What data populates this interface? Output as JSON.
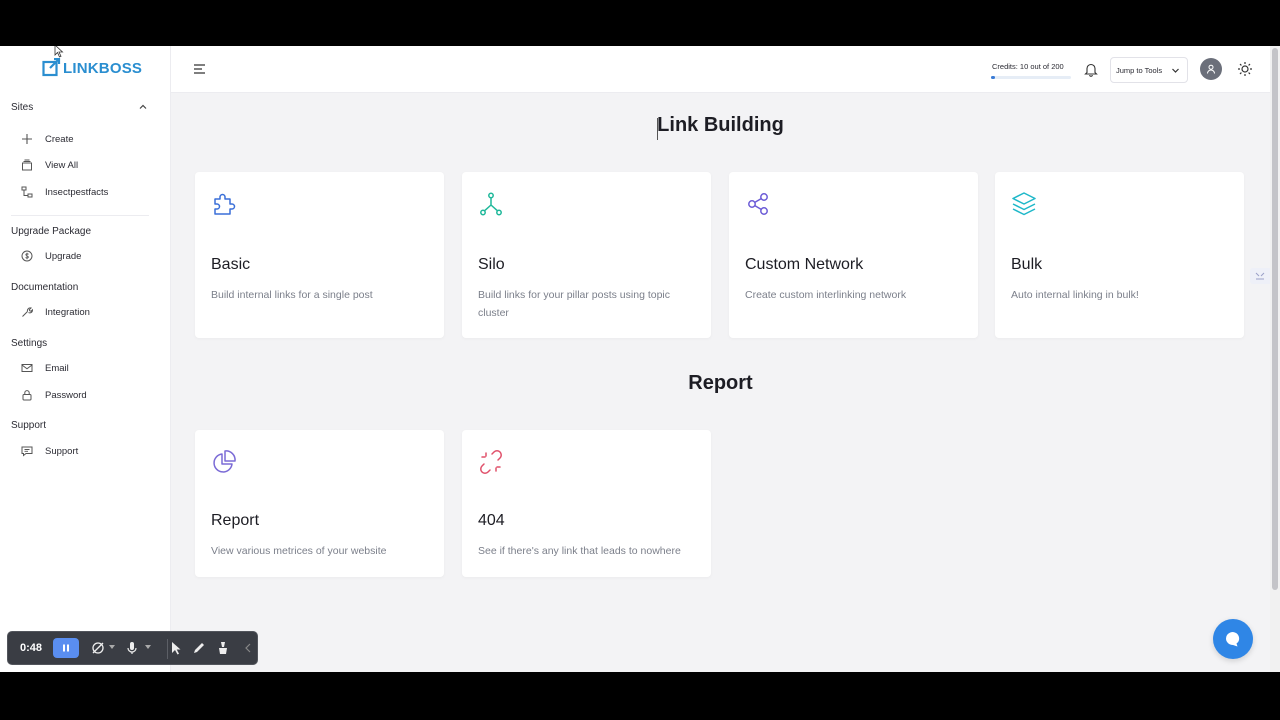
{
  "sidebar": {
    "logo_text": "LINKBOSS",
    "sites_heading": "Sites",
    "sites_items": [
      {
        "label": "Create",
        "icon": "plus-icon"
      },
      {
        "label": "View All",
        "icon": "stack-icon"
      },
      {
        "label": "Insectpestfacts",
        "icon": "sitemap-icon"
      }
    ],
    "upgrade_heading": "Upgrade Package",
    "upgrade_item": {
      "label": "Upgrade",
      "icon": "dollar-circle-icon"
    },
    "docs_heading": "Documentation",
    "docs_item": {
      "label": "Integration",
      "icon": "tool-icon"
    },
    "settings_heading": "Settings",
    "settings_items": [
      {
        "label": "Email",
        "icon": "mail-icon"
      },
      {
        "label": "Password",
        "icon": "lock-icon"
      }
    ],
    "support_heading": "Support",
    "support_item": {
      "label": "Support",
      "icon": "chat-icon"
    }
  },
  "header": {
    "credits_text": "Credits: 10 out of 200",
    "credits_used": 10,
    "credits_total": 200,
    "jump_label": "Jump to Tools"
  },
  "link_building": {
    "title": "Link Building",
    "cards": [
      {
        "title": "Basic",
        "desc": "Build internal links for a single post",
        "icon": "puzzle-icon",
        "color": "#3a6fd8"
      },
      {
        "title": "Silo",
        "desc": "Build links for your pillar posts using topic cluster",
        "icon": "hierarchy-icon",
        "color": "#1fb89a"
      },
      {
        "title": "Custom Network",
        "desc": "Create custom interlinking network",
        "icon": "share-nodes-icon",
        "color": "#6b5bd6"
      },
      {
        "title": "Bulk",
        "desc": "Auto internal linking in bulk!",
        "icon": "layers-icon",
        "color": "#1fb8c9"
      }
    ]
  },
  "report": {
    "title": "Report",
    "cards": [
      {
        "title": "Report",
        "desc": "View various metrices of your website",
        "icon": "pie-chart-icon",
        "color": "#7b6bd6"
      },
      {
        "title": "404",
        "desc": "See if there's any link that leads to nowhere",
        "icon": "broken-link-icon",
        "color": "#e0506a"
      }
    ]
  },
  "recorder": {
    "time": "0:48"
  },
  "colors": {
    "accent": "#2f86e6",
    "logo": "#2a8ed0"
  }
}
